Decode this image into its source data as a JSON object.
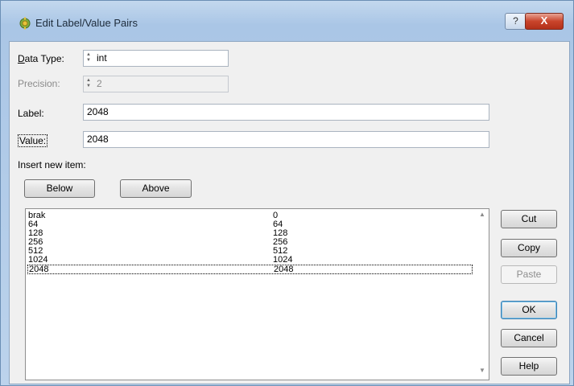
{
  "window": {
    "title": "Edit Label/Value Pairs",
    "help_glyph": "?",
    "close_glyph": "X"
  },
  "form": {
    "data_type_label": "Data Type:",
    "data_type_value": "int",
    "precision_label": "Precision:",
    "precision_value": "2",
    "label_label": "Label:",
    "label_value": "2048",
    "value_label": "Value:",
    "value_value": "2048",
    "insert_new_item_label": "Insert new item:",
    "below_button": "Below",
    "above_button": "Above"
  },
  "list": {
    "rows": [
      {
        "label": "brak",
        "value": "0"
      },
      {
        "label": "64",
        "value": "64"
      },
      {
        "label": "128",
        "value": "128"
      },
      {
        "label": "256",
        "value": "256"
      },
      {
        "label": "512",
        "value": "512"
      },
      {
        "label": "1024",
        "value": "1024"
      },
      {
        "label": "2048",
        "value": "2048"
      }
    ],
    "selected_index": 6
  },
  "side_buttons": {
    "cut": "Cut",
    "copy": "Copy",
    "paste": "Paste",
    "ok": "OK",
    "cancel": "Cancel",
    "help": "Help"
  }
}
